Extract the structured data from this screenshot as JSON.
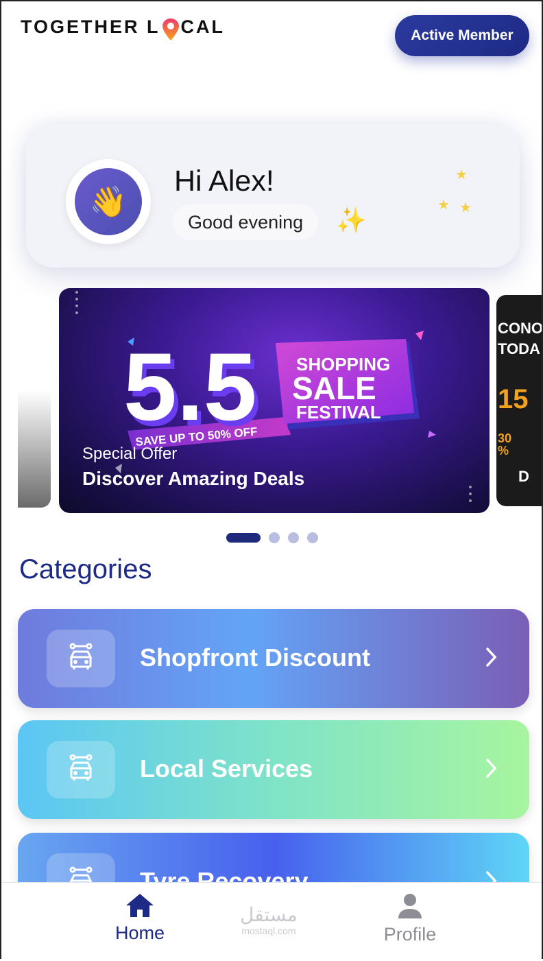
{
  "header": {
    "logo_left": "TOGETHER L",
    "logo_right": "CAL",
    "member_button": "Active Member"
  },
  "greeting": {
    "hello": "Hi Alex!",
    "time_of_day": "Good evening"
  },
  "carousel": {
    "banner": {
      "subtitle": "Special Offer",
      "title": "Discover Amazing Deals",
      "art_headline": "5.5",
      "art_line1": "SHOPPING",
      "art_line2": "SALE",
      "art_line3": "FESTIVAL",
      "art_ribbon": "SAVE UP TO 50% OFF"
    },
    "next_peek": {
      "line1": "CONO",
      "line2": "TODA",
      "line3": "15",
      "line4": "30 %",
      "line5": "D"
    },
    "dots_total": 4,
    "active_index": 0
  },
  "categories": {
    "title": "Categories",
    "items": [
      {
        "label": "Shopfront Discount",
        "icon": "shop-icon"
      },
      {
        "label": "Local Services",
        "icon": "shop-icon"
      },
      {
        "label": "Tyre Recovery",
        "icon": "shop-icon"
      }
    ]
  },
  "bottom_nav": {
    "home": "Home",
    "profile": "Profile"
  },
  "watermark": {
    "arabic": "مستقل",
    "latin": "mostaql.com"
  },
  "colors": {
    "brand_navy": "#1d2b86",
    "member_button": "#2b3a9e",
    "logo_pin": "#e8344f"
  }
}
